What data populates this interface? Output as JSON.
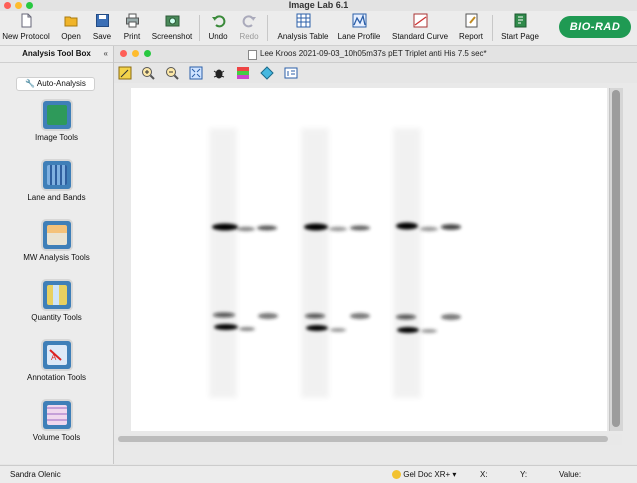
{
  "app": {
    "title": "Image Lab 6.1"
  },
  "toolbar": {
    "new_protocol": "New Protocol",
    "open": "Open",
    "save": "Save",
    "print": "Print",
    "screenshot": "Screenshot",
    "undo": "Undo",
    "redo": "Redo",
    "analysis_table": "Analysis Table",
    "lane_profile": "Lane Profile",
    "standard_curve": "Standard Curve",
    "report": "Report",
    "start_page": "Start Page",
    "logo_text": "BIO-RAD"
  },
  "left_panel": {
    "title": "Analysis Tool Box",
    "collapse": "«",
    "auto_analysis": "Auto-Analysis",
    "tools": [
      {
        "label": "Image Tools",
        "icon": "image-tools-icon"
      },
      {
        "label": "Lane and Bands",
        "icon": "lane-bands-icon"
      },
      {
        "label": "MW Analysis Tools",
        "icon": "mw-analysis-icon"
      },
      {
        "label": "Quantity Tools",
        "icon": "quantity-tools-icon"
      },
      {
        "label": "Annotation Tools",
        "icon": "annotation-tools-icon"
      },
      {
        "label": "Volume Tools",
        "icon": "volume-tools-icon"
      }
    ]
  },
  "document": {
    "title": "Lee Kroos 2021-09-03_10h05m37s pET Triplet anti His 7.5 sec*"
  },
  "status": {
    "user": "Sandra Olenic",
    "device": "Gel Doc XR+",
    "x_label": "X:",
    "y_label": "Y:",
    "value_label": "Value:"
  },
  "colors": {
    "accent_green": "#1f9a53",
    "tool_blue": "#3f7fb8"
  }
}
